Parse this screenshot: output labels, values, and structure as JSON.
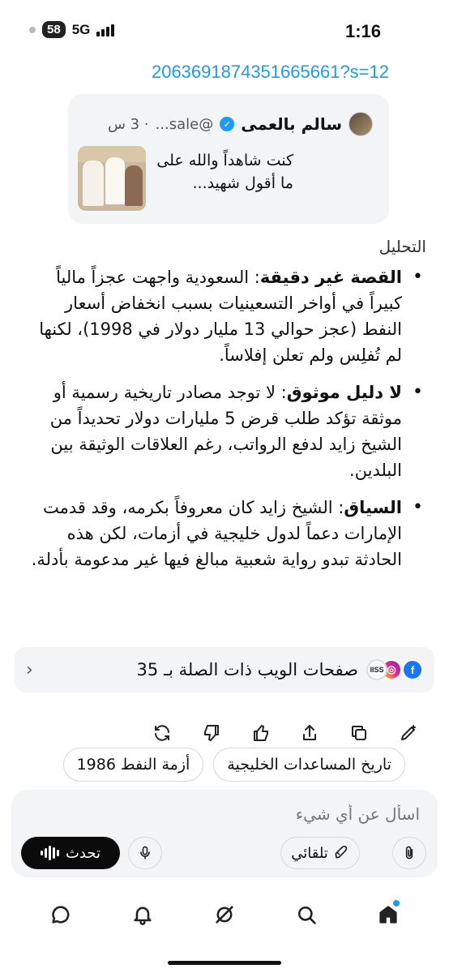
{
  "status_bar": {
    "time": "1:16",
    "battery": "58",
    "network": "5G"
  },
  "link": {
    "text": "2063691874351665661?s=12"
  },
  "quote": {
    "name": "سالم بالعمى",
    "handle": "@sale...",
    "time": "· 3 س",
    "body": "كنت شاهداً والله على ما أقول شهيد..."
  },
  "analysis": {
    "title": "التحليل",
    "items": [
      {
        "term": "القصة غير دقيقة",
        "text": ": السعودية واجهت عجزاً مالياً كبيراً في أواخر التسعينيات بسبب انخفاض أسعار النفط (عجز حوالي 13 مليار دولار في 1998)، لكنها لم تُفلِس ولم تعلن إفلاساً."
      },
      {
        "term": "لا دليل موثوق",
        "text": ": لا توجد مصادر تاريخية رسمية أو موثقة تؤكد طلب قرض 5 مليارات دولار تحديداً من الشيخ زايد لدفع الرواتب، رغم العلاقات الوثيقة بين البلدين."
      },
      {
        "term": "السياق",
        "text": ": الشيخ زايد كان معروفاً بكرمه، وقد قدمت الإمارات دعماً لدول خليجية في أزمات، لكن هذه الحادثة تبدو رواية شعبية مبالغ فيها غير مدعومة بأدلة."
      }
    ]
  },
  "related": {
    "label": "صفحات الويب ذات الصلة بـ 35",
    "icons": [
      "facebook-icon",
      "instagram-icon",
      "iiss-icon"
    ],
    "iiss_text": "IISS"
  },
  "chips": [
    "تاريخ المساعدات الخليجية",
    "أزمة النفط 1986"
  ],
  "input": {
    "placeholder": "اسأل عن أي شيء",
    "talk_label": "تحدث",
    "auto_label": "تلقائي"
  },
  "colors": {
    "accent": "#1d9bf0",
    "card_bg": "#f3f4f6",
    "text": "#111111"
  }
}
